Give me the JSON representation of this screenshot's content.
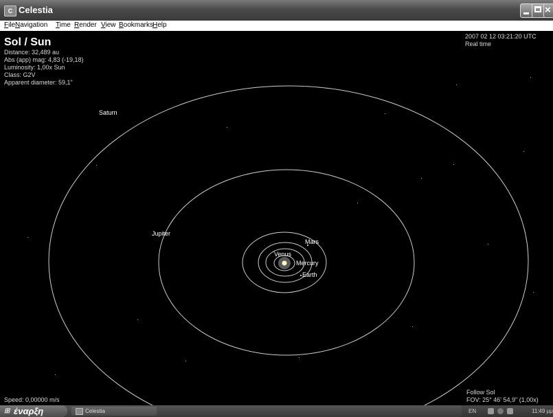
{
  "window": {
    "title": "Celestia",
    "icon": "celestia-app-icon"
  },
  "menu": [
    "File",
    "Navigation",
    "Time",
    "Render",
    "View",
    "Bookmarks",
    "Help"
  ],
  "menu_underline": [
    "F",
    "N",
    "T",
    "R",
    "V",
    "B",
    "H"
  ],
  "object": {
    "name": "Sol / Sun",
    "distance": "Distance: 32,489 au",
    "abs_mag": "Abs (app) mag: 4,83 (-19,18)",
    "luminosity": "Luminosity: 1,00x Sun",
    "class": "Class: G2V",
    "apparent_diameter": "Apparent diameter: 59,1\""
  },
  "time": {
    "datetime": "2007 02 12 03:21:20 UTC",
    "rate": "Real time"
  },
  "planets": {
    "saturn": "Saturn",
    "jupiter": "Jupiter",
    "mars": "Mars",
    "venus": "Venus",
    "mercury": "Mercury",
    "earth": "Earth"
  },
  "speed": "Speed: 0,00000 m/s",
  "follow": "Follow Sol",
  "fov": "FOV: 25° 46' 54,9\" (1,00x)",
  "taskbar": {
    "start": "έναρξη",
    "task": "Celestia",
    "lang": "EN",
    "clock": "11:49 μμ"
  },
  "colors": {
    "orbit": "#cfcfcf",
    "sun": "#fff6c8",
    "background": "#000000"
  }
}
